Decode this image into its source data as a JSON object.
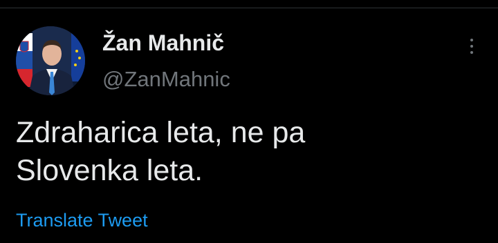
{
  "tweet": {
    "author": {
      "display_name": "Žan Mahnič",
      "handle": "@ZanMahnic",
      "avatar_icon": "profile-photo"
    },
    "text_lines": [
      "Zdraharica leta, ne pa",
      "Slovenka leta."
    ],
    "translate_label": "Translate Tweet",
    "more_icon": "more-vertical-icon"
  },
  "colors": {
    "background": "#000000",
    "primary_text": "#e7e9ea",
    "secondary_text": "#71767b",
    "link": "#1d9bf0",
    "divider": "#2f3336"
  }
}
